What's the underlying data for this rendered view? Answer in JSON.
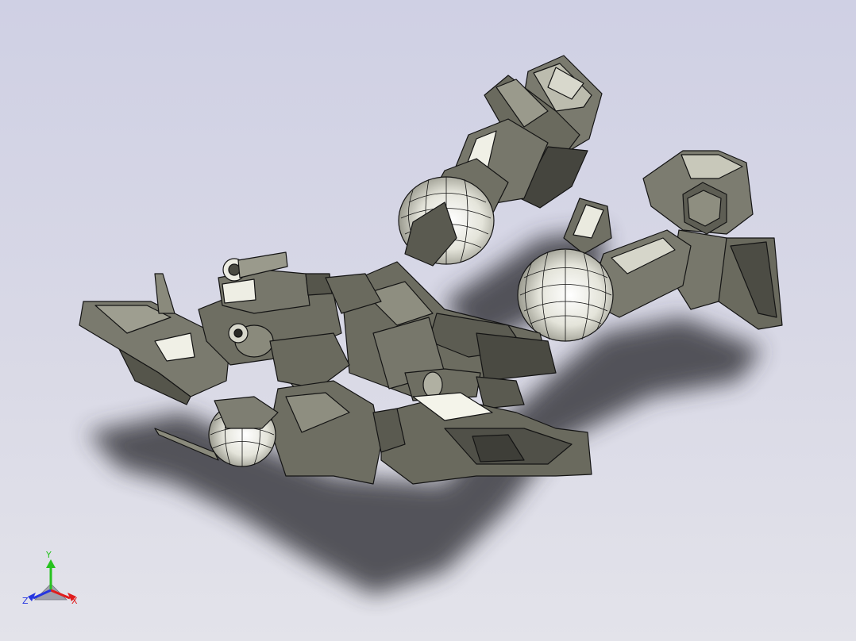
{
  "viewport": {
    "background_top": "#cfd0e4",
    "background_bottom": "#e3e3ea",
    "model_color": "#6e6e62",
    "model_highlight": "#f2f2ea",
    "edge_color": "#141414",
    "shadow_color": "#3a3a40"
  },
  "triad": {
    "y_label": "Y",
    "z_label": "Z",
    "x_label": "X",
    "y_color": "#27c21f",
    "z_color": "#2636e0",
    "x_color": "#e01d1d"
  }
}
